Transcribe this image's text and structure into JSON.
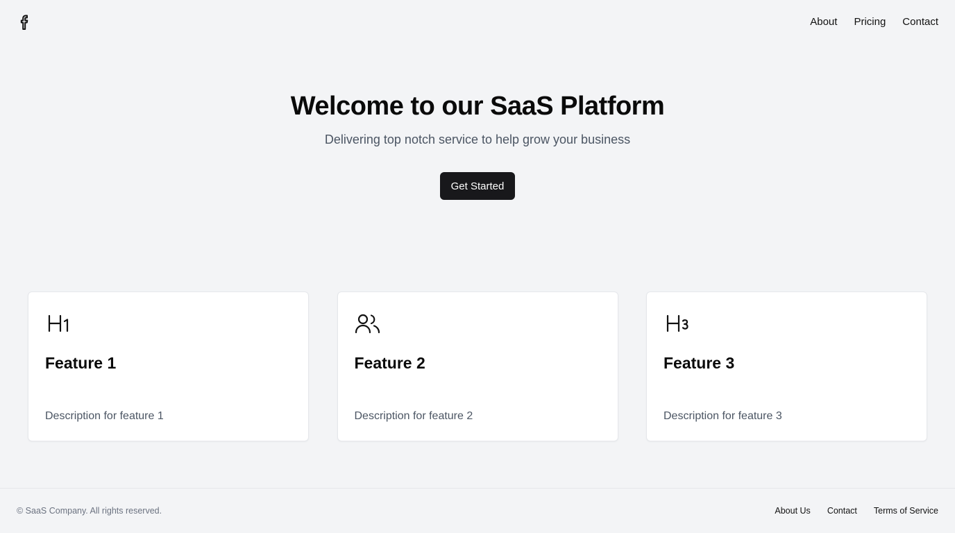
{
  "header": {
    "logo_icon": "facebook-icon",
    "nav": [
      {
        "label": "About"
      },
      {
        "label": "Pricing"
      },
      {
        "label": "Contact"
      }
    ]
  },
  "hero": {
    "title": "Welcome to our SaaS Platform",
    "subtitle": "Delivering top notch service to help grow your business",
    "cta_label": "Get Started",
    "cta_color": "#18181b"
  },
  "features": [
    {
      "icon": "heading-1-icon",
      "title": "Feature 1",
      "description": "Description for feature 1"
    },
    {
      "icon": "users-icon",
      "title": "Feature 2",
      "description": "Description for feature 2"
    },
    {
      "icon": "heading-3-icon",
      "title": "Feature 3",
      "description": "Description for feature 3"
    }
  ],
  "footer": {
    "copyright": "© SaaS Company. All rights reserved.",
    "links": [
      {
        "label": "About Us"
      },
      {
        "label": "Contact"
      },
      {
        "label": "Terms of Service"
      }
    ]
  },
  "colors": {
    "background": "#f3f4f6",
    "card": "#ffffff",
    "text": "#0a0a0a",
    "muted": "#4b5563"
  }
}
